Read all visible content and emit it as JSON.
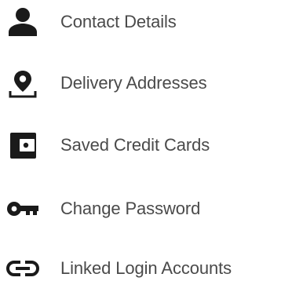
{
  "menu": {
    "items": [
      {
        "label": "Contact Details",
        "icon": "person-icon"
      },
      {
        "label": "Delivery Addresses",
        "icon": "location-pin-icon"
      },
      {
        "label": "Saved Credit Cards",
        "icon": "wallet-icon"
      },
      {
        "label": "Change Password",
        "icon": "key-icon"
      },
      {
        "label": "Linked Login Accounts",
        "icon": "link-icon"
      }
    ]
  },
  "colors": {
    "icon": "#1a1a1a",
    "text": "#4a4a4a",
    "background": "#ffffff"
  }
}
